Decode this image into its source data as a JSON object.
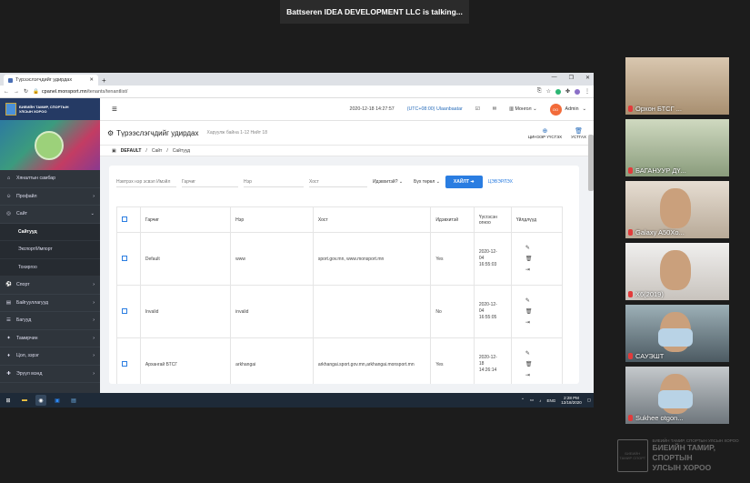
{
  "meeting": {
    "talking": "Battseren IDEA DEVELOPMENT LLC is talking...",
    "participants": [
      "Орхон БТСГ ...",
      "БАГАНУУР ДҮ...",
      "Galaxy A50Xo...",
      "Х6(2019)",
      "САУЭШТ",
      "Sukhee otgon..."
    ]
  },
  "browser": {
    "tab_title": "Түрээслэгчдийг удирдах",
    "url_host": "cpanel.monsport.mn",
    "url_path": "/tenants/tenantlist/"
  },
  "app": {
    "brand_line1": "БИЕИЙН ТАМИР, СПОРТЫН",
    "brand_line2": "УЛСЫН ХОРОО",
    "datetime": "2020-12-18 14:27:57",
    "timezone": "(UTC+08:00) Ulaanbaatar",
    "language": "Монгол",
    "avatar": "OO",
    "user": "Admin"
  },
  "sidebar": {
    "items": [
      {
        "icon": "⌂",
        "label": "Хяналтын самбар",
        "arrow": ""
      },
      {
        "icon": "☺",
        "label": "Профайл",
        "arrow": "›"
      },
      {
        "icon": "◎",
        "label": "Сайт",
        "arrow": "⌄"
      }
    ],
    "subitems": [
      "Сайтууд",
      "Экспорт/Импорт",
      "Тохиргоо"
    ],
    "items2": [
      {
        "icon": "⚽",
        "label": "Спорт",
        "arrow": "›"
      },
      {
        "icon": "▤",
        "label": "Байгууллагууд",
        "arrow": "›"
      },
      {
        "icon": "☰",
        "label": "Багууд",
        "arrow": "›"
      },
      {
        "icon": "✦",
        "label": "Тамирчин",
        "arrow": "›"
      },
      {
        "icon": "♦",
        "label": "Цол, зэрэг",
        "arrow": "›"
      },
      {
        "icon": "✚",
        "label": "Эрүүл мэнд",
        "arrow": "›"
      }
    ]
  },
  "page": {
    "title": "Түрээслэгчдийг удирдах",
    "count": "Харуулж байна 1-12 Нийт 18",
    "action_choose": "ЦИНЭЭР ҮҮСГЭХ",
    "action_delete": "УСТГАХ",
    "breadcrumb": [
      "DEFAULT",
      "Сайт",
      "Сайтууд"
    ]
  },
  "filters": {
    "name_placeholder": "Нэвтрэх нэр эсвэл Имэйл",
    "f1": "Гарчиг",
    "f2": "Нэр",
    "f3": "Хост",
    "active": "Идэвхитэй?",
    "type": "Бүх төрөл",
    "search": "ХАЙЛТ",
    "clear": "ЦЭВЭРЛЭХ"
  },
  "table": {
    "headers": [
      "Гарчиг",
      "Нэр",
      "Хост",
      "Идэвхитэй",
      "Үүсгэсэн огноо",
      "Үйлдлүүд"
    ],
    "rows": [
      {
        "title": "Default",
        "name": "www",
        "host": "sport.gov.mn, www.monsport.mn",
        "active": "Yes",
        "d1": "2020-12-",
        "d2": "04",
        "d3": "16:55:03"
      },
      {
        "title": "Invalid",
        "name": "invalid",
        "host": "",
        "active": "No",
        "d1": "2020-12-",
        "d2": "04",
        "d3": "16:55:05"
      },
      {
        "title": "Архангай БТСГ",
        "name": "arkhangai",
        "host": "arkhangai.sport.gov.mn,arkhangai.monsport.mn",
        "active": "Yes",
        "d1": "2020-12-",
        "d2": "18",
        "d3": "14:26:14"
      }
    ]
  },
  "taskbar": {
    "lang": "ENG",
    "time": "2:28 PM",
    "date": "12/18/2020"
  },
  "watermark": {
    "emblem": "БИЕИЙН ТАМИР СПОРТ",
    "small": "БИЕИЙН ТАМИР, СПОРТЫН УЛСЫН ХОРОО",
    "line1": "БИЕИЙН ТАМИР, СПОРТЫН",
    "line2": "УЛСЫН ХОРОО"
  }
}
